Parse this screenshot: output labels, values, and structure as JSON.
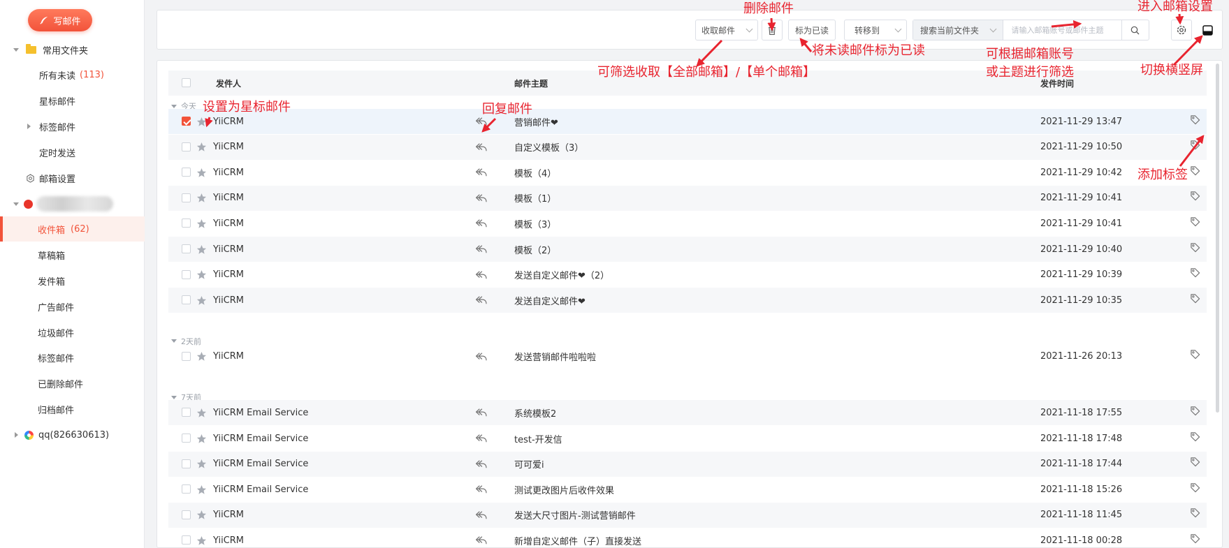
{
  "sidebar": {
    "compose_label": "写邮件",
    "common_folder": "常用文件夹",
    "all_unread": "所有未读",
    "all_unread_count": "(113)",
    "starred": "星标邮件",
    "tagged": "标签邮件",
    "scheduled": "定时发送",
    "mail_settings": "邮箱设置",
    "inbox": "收件箱",
    "inbox_count": "(62)",
    "drafts": "草稿箱",
    "sent": "发件箱",
    "ads": "广告邮件",
    "spam": "垃圾邮件",
    "tag_mail": "标签邮件",
    "deleted": "已删除邮件",
    "archived": "归档邮件",
    "qq_account": "qq(826630613)"
  },
  "toolbar": {
    "fetch_label": "收取邮件",
    "mark_read_label": "标为已读",
    "move_to_label": "转移到",
    "search_scope": "搜索当前文件夹",
    "search_placeholder": "请输入邮箱账号或邮件主题"
  },
  "list": {
    "header": {
      "sender": "发件人",
      "subject": "邮件主题",
      "time": "发件时间"
    },
    "groups": [
      {
        "label": "今天",
        "rows": [
          {
            "sender": "YiiCRM",
            "subject": "营销邮件❤",
            "time": "2021-11-29 13:47",
            "checked": true
          },
          {
            "sender": "YiiCRM",
            "subject": "自定义模板（3）",
            "time": "2021-11-29 10:50",
            "checked": false
          },
          {
            "sender": "YiiCRM",
            "subject": "模板（4）",
            "time": "2021-11-29 10:42",
            "checked": false
          },
          {
            "sender": "YiiCRM",
            "subject": "模板（1）",
            "time": "2021-11-29 10:41",
            "checked": false
          },
          {
            "sender": "YiiCRM",
            "subject": "模板（3）",
            "time": "2021-11-29 10:41",
            "checked": false
          },
          {
            "sender": "YiiCRM",
            "subject": "模板（2）",
            "time": "2021-11-29 10:40",
            "checked": false
          },
          {
            "sender": "YiiCRM",
            "subject": "发送自定义邮件❤（2）",
            "time": "2021-11-29 10:39",
            "checked": false
          },
          {
            "sender": "YiiCRM",
            "subject": "发送自定义邮件❤",
            "time": "2021-11-29 10:35",
            "checked": false
          }
        ]
      },
      {
        "label": "2天前",
        "rows": [
          {
            "sender": "YiiCRM",
            "subject": "发送营销邮件啦啦啦",
            "time": "2021-11-26 20:13",
            "checked": false
          }
        ]
      },
      {
        "label": "7天前",
        "rows": [
          {
            "sender": "YiiCRM Email Service",
            "subject": "系统模板2",
            "time": "2021-11-18 17:55",
            "checked": false
          },
          {
            "sender": "YiiCRM Email Service",
            "subject": "test-开发信",
            "time": "2021-11-18 17:48",
            "checked": false
          },
          {
            "sender": "YiiCRM Email Service",
            "subject": "可可爱i",
            "time": "2021-11-18 17:44",
            "checked": false
          },
          {
            "sender": "YiiCRM Email Service",
            "subject": "测试更改图片后收件效果",
            "time": "2021-11-18 15:26",
            "checked": false
          },
          {
            "sender": "YiiCRM",
            "subject": "发送大尺寸图片-测试营销邮件",
            "time": "2021-11-18 11:45",
            "checked": false
          },
          {
            "sender": "YiiCRM",
            "subject": "新增自定义邮件（子）直接发送",
            "time": "2021-11-18 00:28",
            "checked": false
          }
        ]
      }
    ]
  },
  "annotations": {
    "delete": "删除邮件",
    "enter_settings": "进入邮箱设置",
    "mark_read": "将未读邮件标为已读",
    "filter_fetch": "可筛选收取【全部邮箱】/【单个邮箱】",
    "filter_search_1": "可根据邮箱账号",
    "filter_search_2": "或主题进行筛选",
    "switch_layout": "切换横竖屏",
    "set_star": "设置为星标邮件",
    "reply": "回复邮件",
    "add_tag": "添加标签"
  },
  "colors": {
    "accent": "#f2533a",
    "annotation": "#e8242f"
  }
}
